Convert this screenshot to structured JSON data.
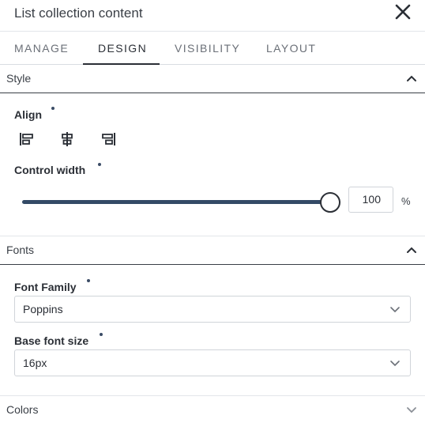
{
  "header": {
    "title": "List collection content",
    "close_icon": "close-icon"
  },
  "tabs": [
    {
      "label": "MANAGE",
      "active": false
    },
    {
      "label": "DESIGN",
      "active": true
    },
    {
      "label": "VISIBILITY",
      "active": false
    },
    {
      "label": "LAYOUT",
      "active": false
    }
  ],
  "style_section": {
    "label": "Style",
    "expanded": true,
    "align": {
      "label": "Align",
      "options": [
        "align-left-icon",
        "align-center-icon",
        "align-right-icon"
      ]
    },
    "control_width": {
      "label": "Control width",
      "value": "100",
      "unit": "%",
      "fraction": 1.0
    }
  },
  "fonts_section": {
    "label": "Fonts",
    "expanded": true,
    "font_family": {
      "label": "Font Family",
      "value": "Poppins"
    },
    "base_font_size": {
      "label": "Base font size",
      "value": "16px"
    }
  },
  "colors_section": {
    "label": "Colors",
    "expanded": false
  },
  "colors": {
    "accent": "#2b2f36",
    "slider": "#334a66",
    "dot": "#3b4c66"
  }
}
